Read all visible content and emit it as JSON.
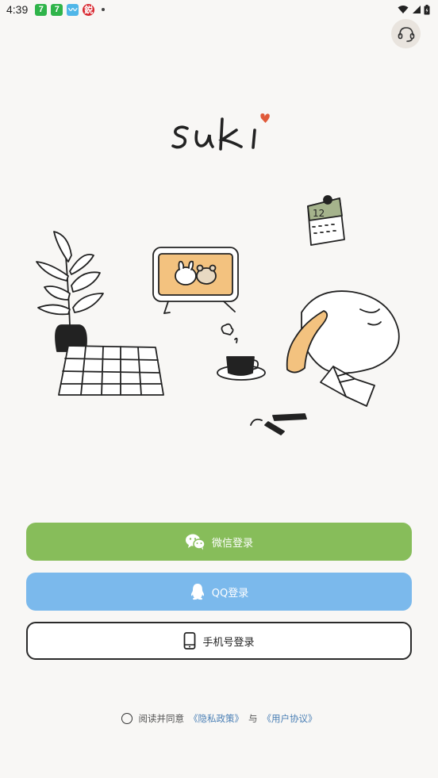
{
  "status_bar": {
    "time": "4:39",
    "app_badges": [
      {
        "icon": "app-7-icon",
        "glyph": "7",
        "color": "#2fb44a"
      },
      {
        "icon": "app-7-icon",
        "glyph": "7",
        "color": "#2fb44a"
      },
      {
        "icon": "app-wave-icon",
        "glyph": "〰",
        "color": "#4fb6e8"
      },
      {
        "icon": "app-seal-icon",
        "glyph": "鋭",
        "color": "#d8262e"
      }
    ]
  },
  "logo": {
    "text": "suki"
  },
  "buttons": {
    "wechat": "微信登录",
    "qq": "QQ登录",
    "phone": "手机号登录"
  },
  "agreement": {
    "prefix": "阅读并同意",
    "privacy": "《隐私政策》",
    "and": "与",
    "terms": "《用户协议》"
  },
  "colors": {
    "background": "#f8f7f5",
    "wechat": "#87bd5a",
    "qq": "#7bb9ec",
    "link": "#4a7fb5",
    "heart": "#e05a3a",
    "accent_orange": "#f3c27f"
  }
}
